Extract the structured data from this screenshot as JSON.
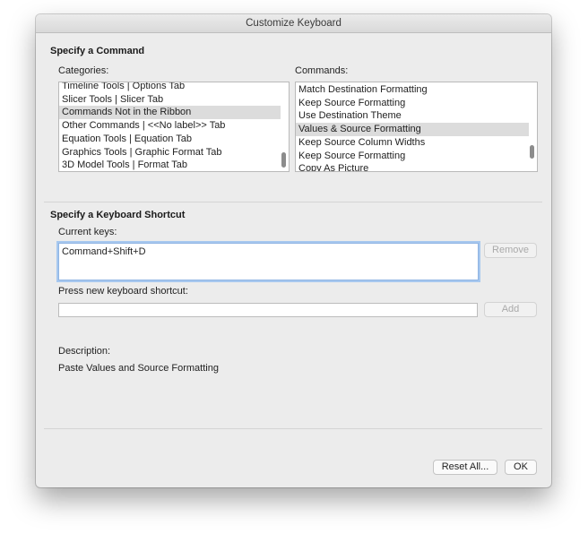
{
  "window": {
    "title": "Customize Keyboard"
  },
  "command_section": {
    "title": "Specify a Command",
    "categories_label": "Categories:",
    "commands_label": "Commands:",
    "categories": [
      {
        "label": "Timeline Tools | Options Tab",
        "selected": false
      },
      {
        "label": "Slicer Tools | Slicer Tab",
        "selected": false
      },
      {
        "label": "Commands Not in the Ribbon",
        "selected": true
      },
      {
        "label": "Other Commands | <<No label>> Tab",
        "selected": false
      },
      {
        "label": "Equation Tools | Equation Tab",
        "selected": false
      },
      {
        "label": "Graphics Tools | Graphic Format Tab",
        "selected": false
      },
      {
        "label": "3D Model Tools | Format Tab",
        "selected": false
      }
    ],
    "commands": [
      {
        "label": "Match Destination Formatting",
        "selected": false
      },
      {
        "label": "Keep Source Formatting",
        "selected": false
      },
      {
        "label": "Use Destination Theme",
        "selected": false
      },
      {
        "label": "Values & Source Formatting",
        "selected": true
      },
      {
        "label": "Keep Source Column Widths",
        "selected": false
      },
      {
        "label": "Keep Source Formatting",
        "selected": false
      },
      {
        "label": "Copy As Picture",
        "selected": false
      }
    ]
  },
  "shortcut_section": {
    "title": "Specify a Keyboard Shortcut",
    "current_keys_label": "Current keys:",
    "current_keys_value": "Command+Shift+D",
    "remove_label": "Remove",
    "new_shortcut_label": "Press new keyboard shortcut:",
    "new_shortcut_value": "",
    "add_label": "Add",
    "description_label": "Description:",
    "description_text": "Paste Values and Source Formatting"
  },
  "footer": {
    "reset_all_label": "Reset All...",
    "ok_label": "OK"
  }
}
